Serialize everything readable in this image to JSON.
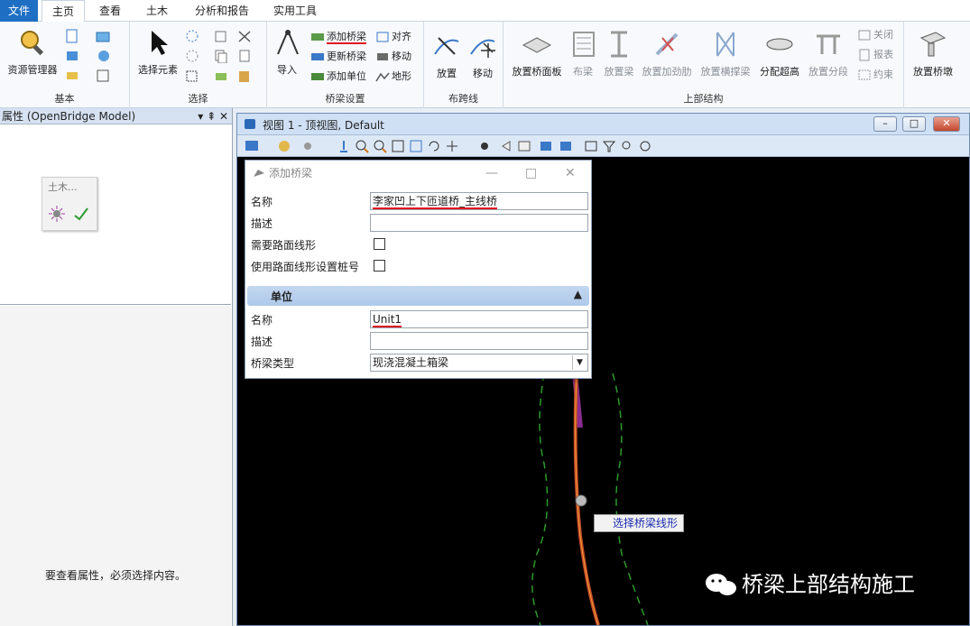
{
  "ribbon_tabs": [
    {
      "label": "文件"
    },
    {
      "label": "主页"
    },
    {
      "label": "查看"
    },
    {
      "label": "土木"
    },
    {
      "label": "分析和报告"
    },
    {
      "label": "实用工具"
    }
  ],
  "groups": {
    "basic": {
      "label": "基本",
      "resource_manager": "资源管理器"
    },
    "select": {
      "label": "选择",
      "select_element": "选择元素"
    },
    "bridge_setup": {
      "label": "桥梁设置",
      "import": "导入",
      "add_bridge": "添加桥梁",
      "align": "对齐",
      "update_bridge": "更新桥梁",
      "move": "移动",
      "add_unit": "添加单位",
      "terrain": "地形"
    },
    "span_lines": {
      "label": "布跨线",
      "place": "放置",
      "move": "移动"
    },
    "superstructure": {
      "label": "上部结构",
      "place_deck": "放置桥面板",
      "lay_beam": "布梁",
      "place_beam": "放置梁",
      "place_stiffener": "放置加劲肋",
      "place_crossbeam": "放置横撑梁",
      "assign_superelevation": "分配超高",
      "place_segment": "放置分段",
      "close": "关闭",
      "report": "报表",
      "constraint": "约束"
    },
    "pier": {
      "place_pier": "放置桥墩"
    }
  },
  "properties_panel": {
    "title": "属性 (OpenBridge Model)",
    "controls": "▾ ⇞ ✕",
    "mini_toolbar_label": "土木...",
    "empty_message": "要查看属性，必须选择内容。"
  },
  "view": {
    "title": "视图 1 - 顶视图, Default",
    "tooltip": "选择桥梁线形"
  },
  "dialog": {
    "title": "添加桥梁",
    "name_label": "名称",
    "name_value": "李家凹上下匝道桥_主线桥",
    "desc_label": "描述",
    "desc_value": "",
    "need_alignment_label": "需要路面线形",
    "use_alignment_station_label": "使用路面线形设置桩号",
    "unit_section": "单位",
    "unit_name_label": "名称",
    "unit_name_value": "Unit1",
    "unit_desc_label": "描述",
    "unit_desc_value": "",
    "bridge_type_label": "桥梁类型",
    "bridge_type_value": "现浇混凝土箱梁"
  },
  "watermark": "桥梁上部结构施工",
  "colors": {
    "file_tab": "#1e6fc4",
    "annotation_underline": "#e0141c",
    "alignment_line": "#c34a2a",
    "alignment_highlight": "#8b2d8f",
    "offset_lines": "#2a9a2a"
  }
}
